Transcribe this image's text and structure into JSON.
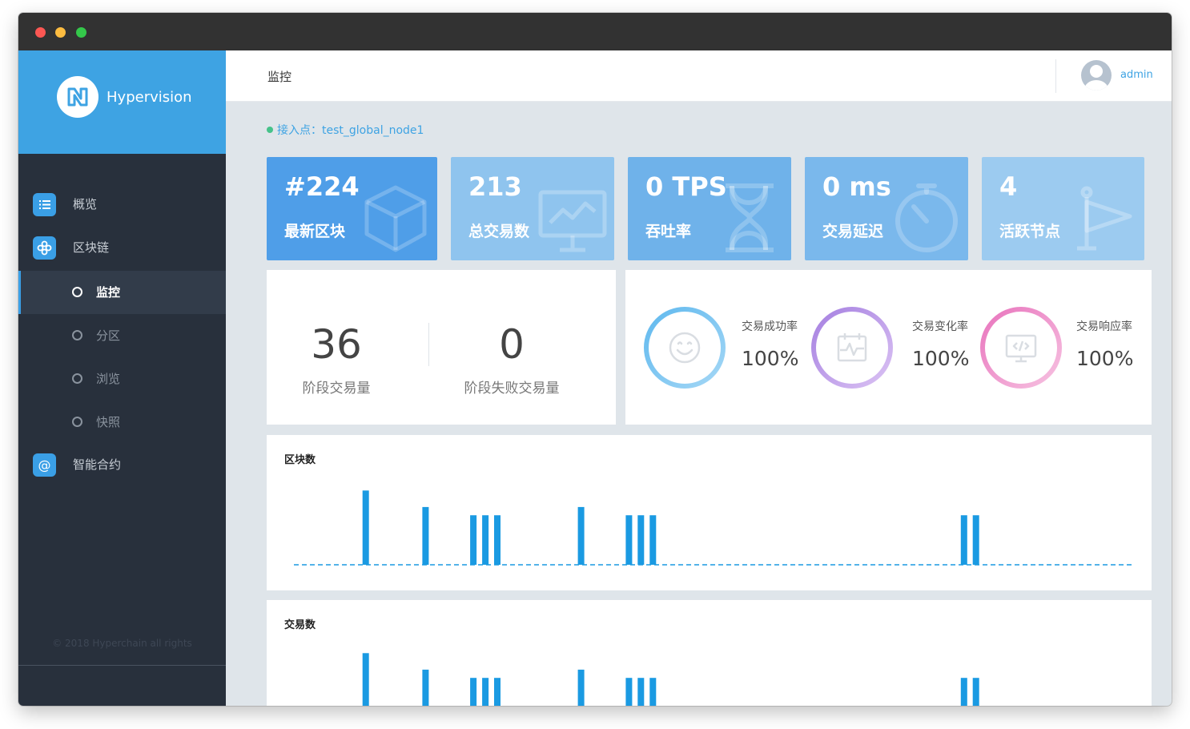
{
  "app": {
    "brand": "Hypervision"
  },
  "sidebar": {
    "items": [
      {
        "label": "概览",
        "icon": "list-icon"
      },
      {
        "label": "区块链",
        "icon": "blockchain-icon"
      },
      {
        "label": "智能合约",
        "icon": "at-icon"
      }
    ],
    "sub_items": [
      {
        "label": "监控",
        "active": true
      },
      {
        "label": "分区",
        "active": false
      },
      {
        "label": "浏览",
        "active": false
      },
      {
        "label": "快照",
        "active": false
      }
    ],
    "copyright": "© 2018 Hyperchain all rights"
  },
  "header": {
    "title": "监控",
    "user": "admin"
  },
  "access_point": {
    "label": "接入点：",
    "value": "test_global_node1"
  },
  "stats": [
    {
      "value": "#224",
      "label": "最新区块",
      "icon": "cube-icon",
      "color": "#4f9ee8"
    },
    {
      "value": "213",
      "label": "总交易数",
      "icon": "presentation-chart-icon",
      "color": "#8fc4ee"
    },
    {
      "value": "0 TPS",
      "label": "吞吐率",
      "icon": "hourglass-icon",
      "color": "#6fb2ea"
    },
    {
      "value": "0 ms",
      "label": "交易延迟",
      "icon": "stopwatch-icon",
      "color": "#7ab8ec"
    },
    {
      "value": "4",
      "label": "活跃节点",
      "icon": "flag-icon",
      "color": "#9ccbf0"
    }
  ],
  "metrics": [
    {
      "value": "36",
      "label": "阶段交易量"
    },
    {
      "value": "0",
      "label": "阶段失败交易量"
    }
  ],
  "rates": [
    {
      "label": "交易成功率",
      "value": "100%",
      "icon": "smile-icon",
      "color": "#6bbbee"
    },
    {
      "label": "交易变化率",
      "value": "100%",
      "icon": "calendar-pulse-icon",
      "color": "#b48ee0"
    },
    {
      "label": "交易响应率",
      "value": "100%",
      "icon": "monitor-code-icon",
      "color": "#ec86c4"
    }
  ],
  "colors": {
    "accent": "#3ea3e3",
    "bar": "#1a9ae2",
    "sidebar": "#28303c"
  },
  "charts": {
    "blocks": {
      "title": "区块数"
    },
    "transactions": {
      "title": "交易数"
    }
  },
  "chart_data": [
    {
      "type": "bar",
      "title": "区块数",
      "x": [
        6,
        11,
        15,
        16,
        17,
        24,
        28,
        29,
        30,
        56,
        57
      ],
      "values": [
        9,
        7,
        6,
        6,
        6,
        7,
        6,
        6,
        6,
        6,
        6
      ],
      "xlim": [
        0,
        70
      ],
      "ylim": [
        0,
        10
      ]
    },
    {
      "type": "bar",
      "title": "交易数",
      "x": [
        6,
        11,
        15,
        16,
        17,
        24,
        28,
        29,
        30,
        56,
        57
      ],
      "values": [
        9,
        7,
        6,
        6,
        6,
        7,
        6,
        6,
        6,
        6,
        6
      ],
      "xlim": [
        0,
        70
      ],
      "ylim": [
        0,
        10
      ]
    }
  ]
}
